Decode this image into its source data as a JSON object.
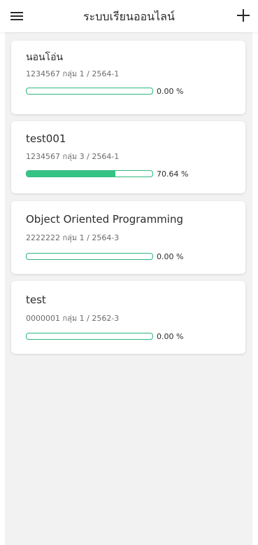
{
  "app_bar": {
    "title": "ระบบเรียนออนไลน์",
    "menu_icon": "hamburger-menu-icon",
    "add_icon": "plus-icon"
  },
  "colors": {
    "accent": "#34c384",
    "background": "#f2f2f2",
    "card": "#ffffff"
  },
  "courses": [
    {
      "name": "นอนโอ่น",
      "meta": "1234567 กลุ่ม 1 / 2564-1",
      "progress": 0.0,
      "progress_label": "0.00 %"
    },
    {
      "name": "test001",
      "meta": "1234567 กลุ่ม 3 / 2564-1",
      "progress": 70.64,
      "progress_label": "70.64 %"
    },
    {
      "name": "Object Oriented Programming",
      "meta": "2222222 กลุ่ม 1 / 2564-3",
      "progress": 0.0,
      "progress_label": "0.00 %"
    },
    {
      "name": "test",
      "meta": "0000001 กลุ่ม 1 / 2562-3",
      "progress": 0.0,
      "progress_label": "0.00 %"
    }
  ]
}
